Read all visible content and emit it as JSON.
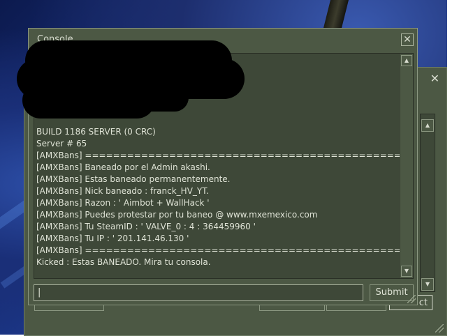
{
  "console": {
    "title": "Console",
    "close_glyph": "✕",
    "lines": [
      "BUILD 1186 SERVER (0 CRC)",
      "Server # 65",
      "[AMXBans] ================================================",
      "[AMXBans] Baneado por el Admin akashi.",
      "[AMXBans] Estas baneado permanentemente.",
      "[AMXBans] Nick baneado : franck_HV_YT.",
      "[AMXBans] Razon : ' Aimbot + WallHack '",
      "[AMXBans] Puedes protestar por tu baneo @ www.mxemexico.com",
      "[AMXBans] Tu SteamID : ' VALVE_0 : 4 : 364459960 '",
      "[AMXBans] Tu IP : ' 201.141.46.130 '",
      "[AMXBans] ================================================",
      "Kicked : Estas BANEADO. Mira tu consola."
    ],
    "input_value": "|",
    "submit_label": "Submit",
    "scroll_up_icon": "▲",
    "scroll_down_icon": "▼"
  },
  "background_dialog": {
    "close_glyph": "✕",
    "button_label": "ct"
  },
  "colors": {
    "panel": "#4c5844",
    "field": "#3e4838",
    "text": "#dfe3d6"
  }
}
